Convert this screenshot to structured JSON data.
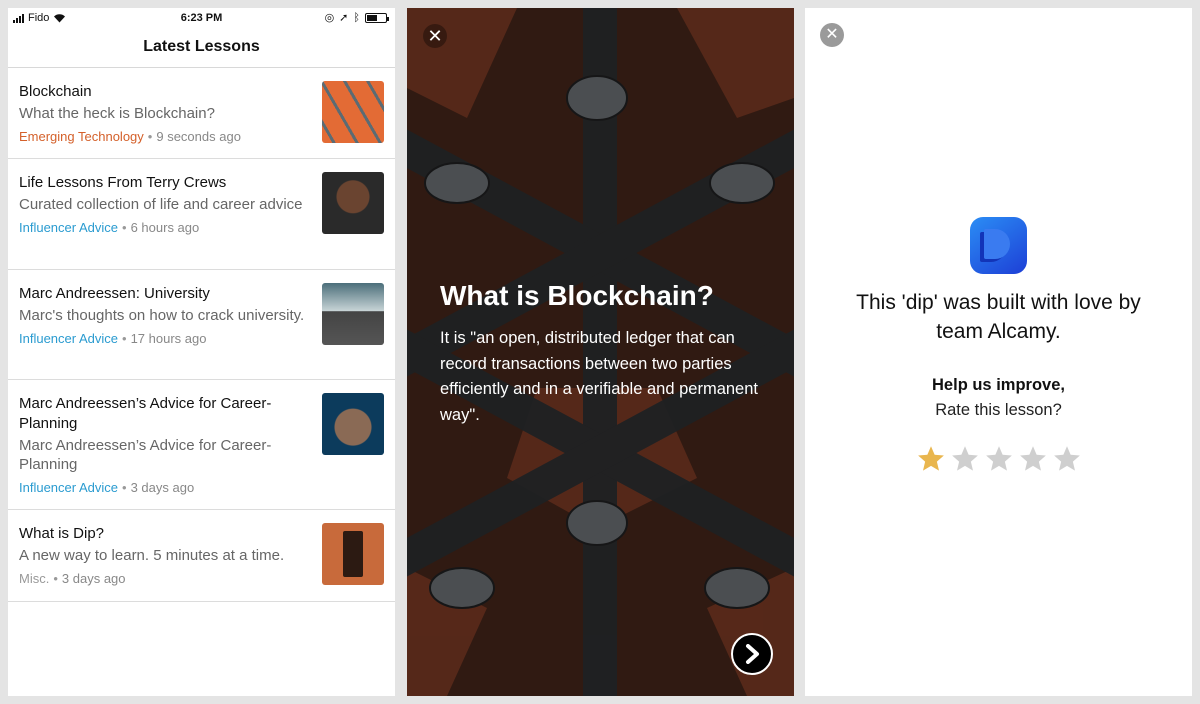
{
  "status": {
    "carrier": "Fido",
    "time": "6:23 PM",
    "battery_level": 0.55
  },
  "list": {
    "title": "Latest Lessons",
    "items": [
      {
        "title": "Blockchain",
        "description": "What the heck is Blockchain?",
        "category": "Emerging Technology",
        "category_color": "#d4602a",
        "time": "9 seconds ago"
      },
      {
        "title": "Life Lessons From Terry Crews",
        "description": "Curated collection of life and career advice",
        "category": "Influencer Advice",
        "category_color": "#2a9bd0",
        "time": "6 hours ago"
      },
      {
        "title": "Marc Andreessen: University",
        "description": "Marc's thoughts on how to crack university.",
        "category": "Influencer Advice",
        "category_color": "#2a9bd0",
        "time": "17 hours ago"
      },
      {
        "title": "Marc Andreessen’s Advice for Career-Planning",
        "description": "Marc Andreessen’s Advice for Career-Planning",
        "category": "Influencer Advice",
        "category_color": "#2a9bd0",
        "time": "3 days ago"
      },
      {
        "title": "What is Dip?",
        "description": "A new way to learn. 5 minutes at a time.",
        "category": "Misc.",
        "category_color": "#999999",
        "time": "3 days ago"
      }
    ]
  },
  "lesson_card": {
    "title": "What is Blockchain?",
    "body": "It is \"an open, distributed ledger that can record transactions between two parties efficiently and in a verifiable and permanent way\"."
  },
  "rating": {
    "built_text": "This 'dip' was built with love by team Alcamy.",
    "help": "Help us improve,",
    "prompt": "Rate this lesson?",
    "stars_total": 5,
    "stars_selected": 1,
    "star_on_color": "#e9b64e",
    "star_off_color": "#cfcfcf"
  }
}
